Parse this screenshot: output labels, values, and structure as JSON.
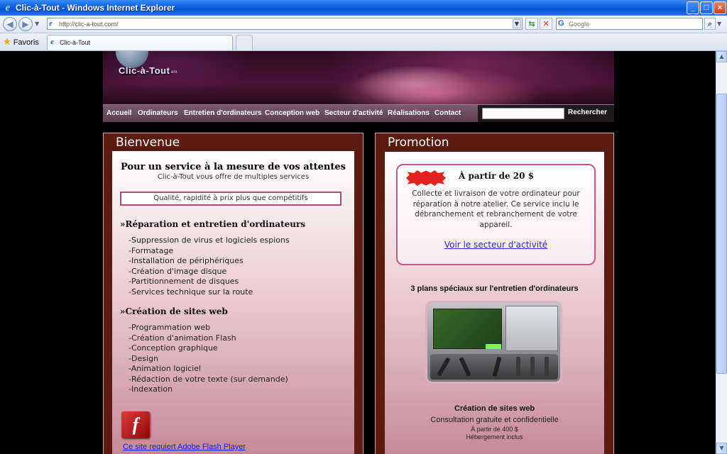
{
  "window": {
    "title": "Clic-à-Tout - Windows Internet Explorer",
    "buttons": {
      "minimize": "_",
      "maximize": "□",
      "close": "×"
    }
  },
  "browser": {
    "url": "http://clic-a-tout.com/",
    "search_placeholder": "Google",
    "favorites_label": "Favoris",
    "tab_label": "Clic-à-Tout"
  },
  "site": {
    "logo_text": "Clic-à-Tout",
    "logo_sub": "enr",
    "nav": [
      "Accueil",
      "Ordinateurs",
      "Entretien d'ordinateurs",
      "Conception web",
      "Secteur d'activité",
      "Réalisations",
      "Contact"
    ],
    "search_button": "Rechercher",
    "search_value": ""
  },
  "welcome": {
    "heading": "Bienvenue",
    "title": "Pour un service à la mesure de vos attentes",
    "subtitle": "Clic-à-Tout vous offre de multiples services",
    "highlight": "Qualité, rapidité à prix plus que compétitifs",
    "sections": [
      {
        "title": "»Réparation et entretien d'ordinateurs",
        "items": [
          "-Suppression de virus et logiciels espions",
          "-Formatage",
          "-Installation de périphériques",
          "-Création d'image disque",
          "-Partitionnement de disques",
          "-Services technique sur la route"
        ]
      },
      {
        "title": "»Création de sites web",
        "items": [
          "-Programmation web",
          "-Création d'animation Flash",
          "-Conception graphique",
          "-Design",
          "-Animation logiciel",
          "-Rédaction de votre texte (sur demande)",
          "-Indexation"
        ]
      }
    ],
    "flash_link": "Ce site requiert Adobe Flash Player"
  },
  "promotion": {
    "heading": "Promotion",
    "card_title": "À partir de 20 $",
    "card_text": "Collecte et livraison de votre ordinateur pour réparation à notre atelier. Ce service inclu le débranchement et rebranchement de votre appareil.",
    "card_link": "Voir le secteur d'activité",
    "plans_title": "3 plans spéciaux sur l'entretien d'ordinateurs",
    "web_title": "Création de sites web",
    "web_line1": "Consultation gratuite et confidentielle",
    "web_line2": "À partir de 400 $",
    "web_line3": "Hébergement inclus"
  }
}
